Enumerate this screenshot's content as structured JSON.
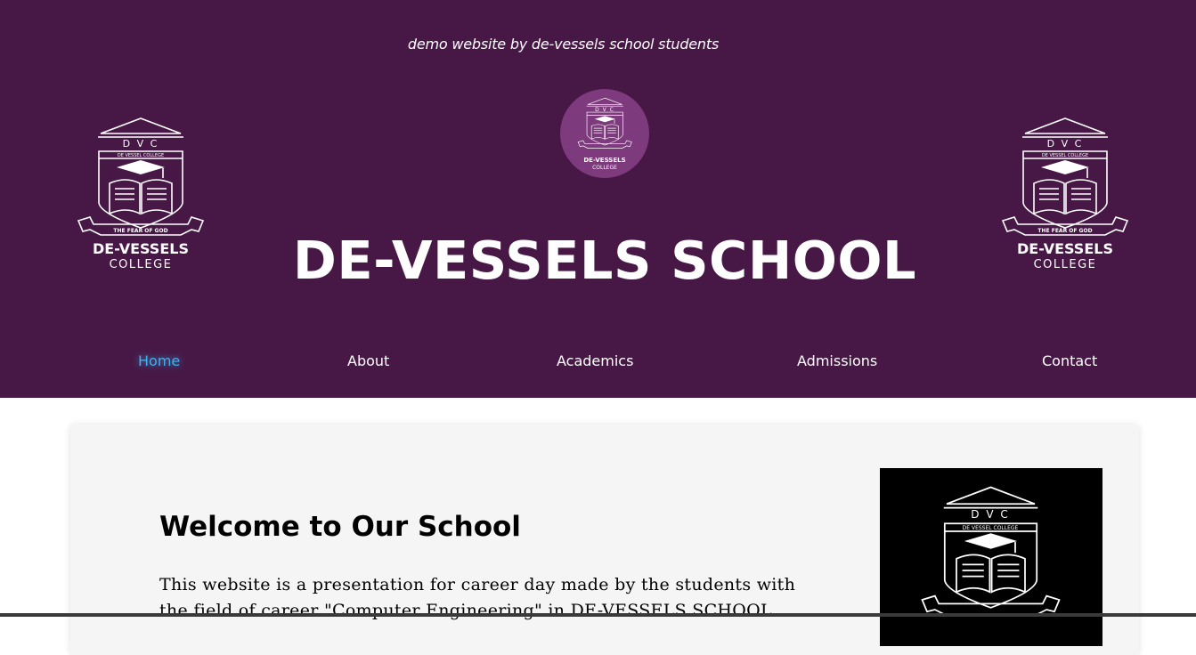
{
  "header": {
    "tagline": "demo website by de-vessels school students",
    "title": "DE-VESSELS SCHOOL",
    "background_color": "#471846",
    "crest": {
      "initials": "D V C",
      "college_name_small": "DE VESSEL COLLEGE",
      "motto": "THE FEAR OF GOD",
      "name_line1": "DE-VESSELS",
      "name_line2": "COLLEGE"
    }
  },
  "nav": {
    "items": [
      {
        "label": "Home",
        "active": true
      },
      {
        "label": "About"
      },
      {
        "label": "Academics"
      },
      {
        "label": "Admissions"
      },
      {
        "label": "Contact"
      }
    ],
    "active_color": "#3fb0ea"
  },
  "main": {
    "heading": "Welcome to Our School",
    "intro": "This website is a presentation for career day made by the students with the field of career \"Computer Engineering\" in DE-VESSELS SCHOOL"
  }
}
